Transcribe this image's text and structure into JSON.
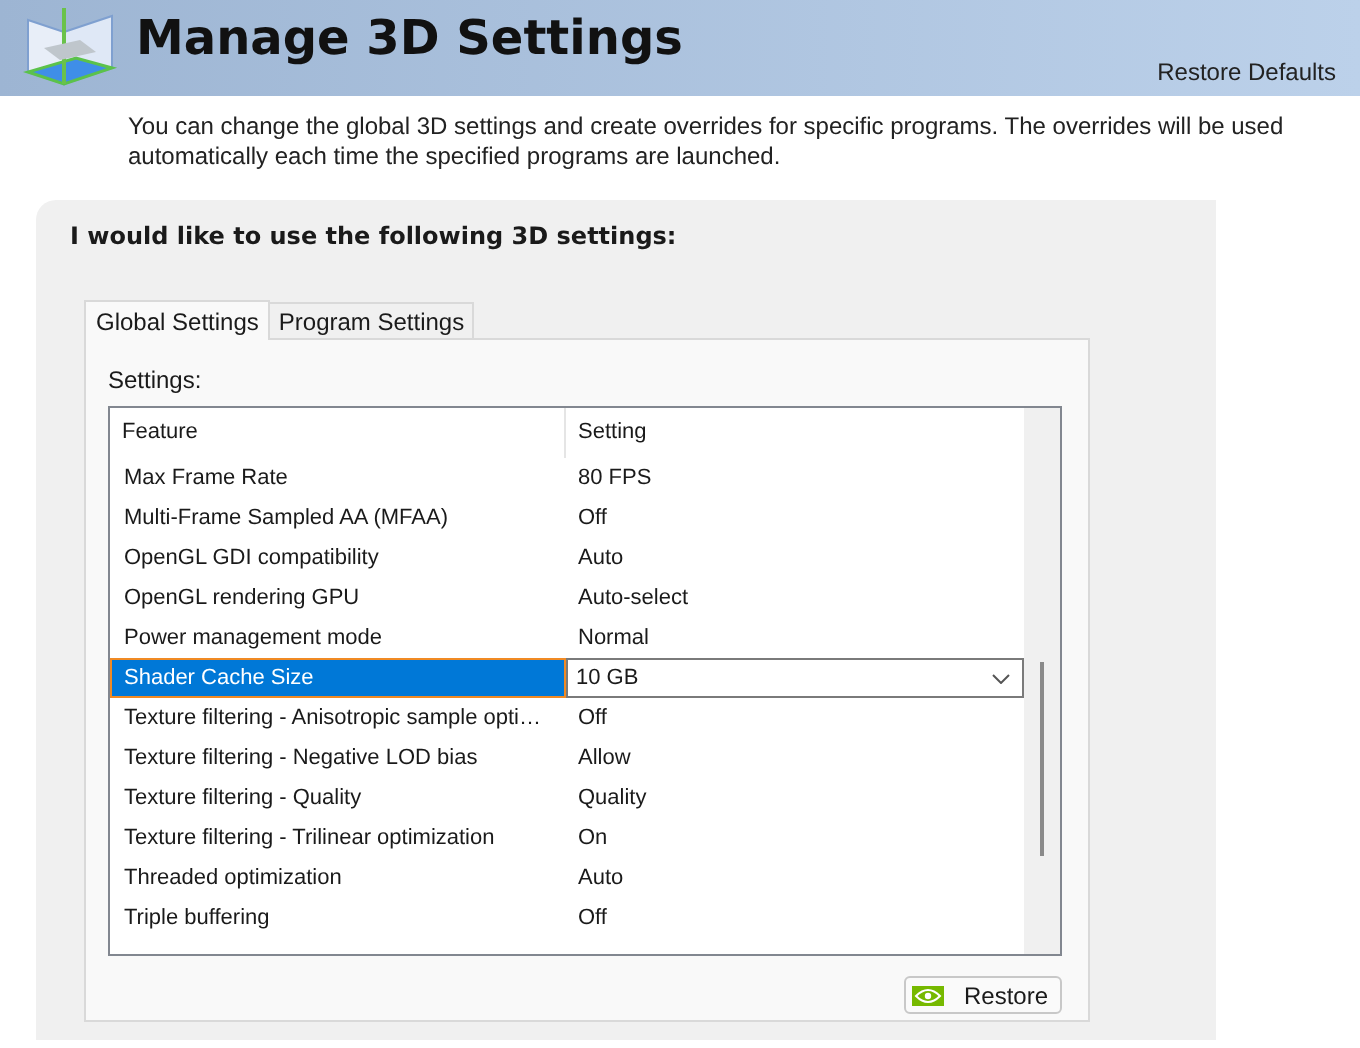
{
  "header": {
    "title": "Manage 3D Settings",
    "restore_defaults": "Restore Defaults"
  },
  "description": "You can change the global 3D settings and create overrides for specific programs. The overrides will be used automatically each time the specified programs are launched.",
  "panel": {
    "heading": "I would like to use the following 3D settings:"
  },
  "tabs": [
    {
      "label": "Global Settings",
      "selected": true
    },
    {
      "label": "Program Settings",
      "selected": false
    }
  ],
  "settings_label": "Settings:",
  "table": {
    "columns": [
      "Feature",
      "Setting"
    ],
    "rows": [
      {
        "feature": "Max Frame Rate",
        "setting": "80 FPS",
        "selected": false
      },
      {
        "feature": "Multi-Frame Sampled AA (MFAA)",
        "setting": "Off",
        "selected": false
      },
      {
        "feature": "OpenGL GDI compatibility",
        "setting": "Auto",
        "selected": false
      },
      {
        "feature": "OpenGL rendering GPU",
        "setting": "Auto-select",
        "selected": false
      },
      {
        "feature": "Power management mode",
        "setting": "Normal",
        "selected": false
      },
      {
        "feature": "Shader Cache Size",
        "setting": "10 GB",
        "selected": true
      },
      {
        "feature": "Texture filtering - Anisotropic sample opti…",
        "setting": "Off",
        "selected": false
      },
      {
        "feature": "Texture filtering - Negative LOD bias",
        "setting": "Allow",
        "selected": false
      },
      {
        "feature": "Texture filtering - Quality",
        "setting": "Quality",
        "selected": false
      },
      {
        "feature": "Texture filtering - Trilinear optimization",
        "setting": "On",
        "selected": false
      },
      {
        "feature": "Threaded optimization",
        "setting": "Auto",
        "selected": false
      },
      {
        "feature": "Triple buffering",
        "setting": "Off",
        "selected": false
      }
    ]
  },
  "restore_button": "Restore"
}
